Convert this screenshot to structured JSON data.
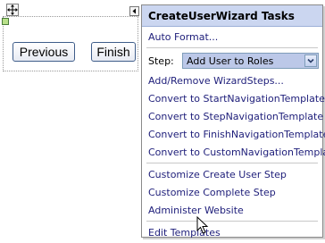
{
  "designer": {
    "previous_label": "Previous",
    "finish_label": "Finish"
  },
  "smart_tag": {
    "title": "CreateUserWizard Tasks",
    "auto_format": "Auto Format...",
    "step_label": "Step:",
    "step_value": "Add User to Roles",
    "nav_items": [
      "Add/Remove WizardSteps...",
      "Convert to StartNavigationTemplate",
      "Convert to StepNavigationTemplate",
      "Convert to FinishNavigationTemplate",
      "Convert to CustomNavigationTemplate"
    ],
    "custom_items": [
      "Customize Create User Step",
      "Customize Complete Step",
      "Administer Website"
    ],
    "edit_templates": "Edit Templates"
  },
  "colors": {
    "header_bg": "#cbd6f0",
    "link": "#1e1e7a",
    "select_bg": "#bcc8e8"
  }
}
